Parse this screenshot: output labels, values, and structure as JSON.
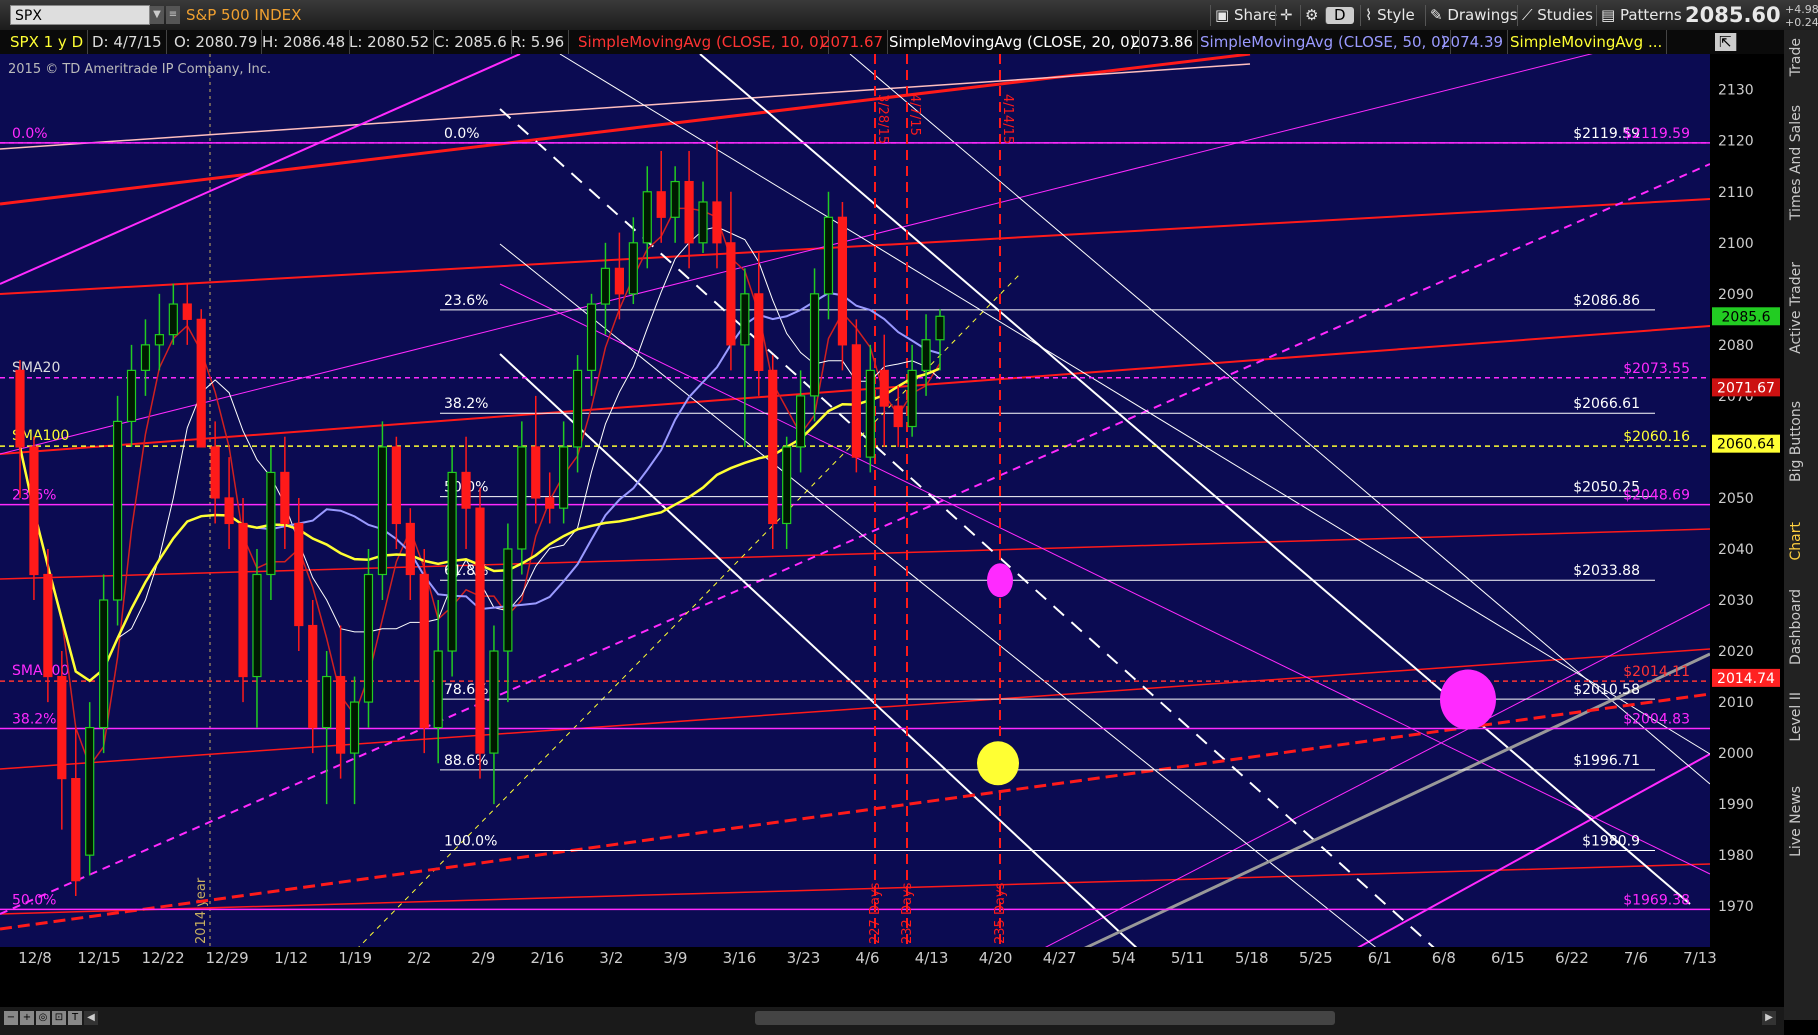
{
  "toolbar": {
    "symbol": "SPX",
    "name": "S&P 500 INDEX",
    "share": "Share",
    "d_label": "D",
    "style": "Style",
    "drawings": "Drawings",
    "studies": "Studies",
    "patterns": "Patterns",
    "last": "2085.60",
    "chg1": "+4.98",
    "chg2": "+0.24%"
  },
  "infobar": {
    "sym": "SPX 1 y D",
    "date": "D: 4/7/15",
    "open": "O: 2080.79",
    "high": "H: 2086.48",
    "low": "L: 2080.52",
    "close": "C: 2085.6",
    "range": "R: 5.96",
    "sma10": "SimpleMovingAvg (CLOSE, 10, 0)",
    "sma10v": "2071.67",
    "sma20": "SimpleMovingAvg (CLOSE, 20, 0)",
    "sma20v": "2073.86",
    "sma50": "SimpleMovingAvg (CLOSE, 50, 0)",
    "sma50v": "2074.39",
    "smaMore": "SimpleMovingAvg ..."
  },
  "copyright": "2015 © TD Ameritrade IP Company, Inc.",
  "colors": {
    "bg": "#0b0b52",
    "red": "#ff1a1a",
    "magenta": "#ff2aff",
    "yellow": "#ffff33",
    "white": "#ffffff",
    "green": "#22cc22"
  },
  "right_tabs": [
    "Trade",
    "Times And Sales",
    "Active Trader",
    "Big Buttons",
    "Chart",
    "Dashboard",
    "Level II",
    "Live News"
  ],
  "chart_data": {
    "type": "candlestick",
    "ylim": [
      1962,
      2137
    ],
    "y_ticks": [
      1970,
      1980,
      1990,
      2000,
      2010,
      2020,
      2030,
      2040,
      2050,
      2060,
      2070,
      2080,
      2090,
      2100,
      2110,
      2120,
      2130
    ],
    "x_ticks": [
      "12/8",
      "12/15",
      "12/22",
      "12/29",
      "1/12",
      "1/19",
      "2/2",
      "2/9",
      "2/16",
      "3/2",
      "3/9",
      "3/16",
      "3/23",
      "4/6",
      "4/13",
      "4/20",
      "4/27",
      "5/4",
      "5/11",
      "5/18",
      "5/25",
      "6/1",
      "6/8",
      "6/15",
      "6/22",
      "7/6",
      "7/13"
    ],
    "fib_right": [
      {
        "pct": "0.0%",
        "price": "$2119.59",
        "value": 2119.59
      },
      {
        "pct": "23.6%",
        "price": "$2086.86",
        "value": 2086.86
      },
      {
        "pct": "38.2%",
        "price": "$2066.61",
        "value": 2066.61
      },
      {
        "pct": "50.0%",
        "price": "$2050.25",
        "value": 2050.25
      },
      {
        "pct": "61.8%",
        "price": "$2033.88",
        "value": 2033.88
      },
      {
        "pct": "78.6%",
        "price": "$2010.58",
        "value": 2010.58
      },
      {
        "pct": "88.6%",
        "price": "$1996.71",
        "value": 1996.71
      },
      {
        "pct": "100.0%",
        "price": "$1980.9",
        "value": 1980.9
      }
    ],
    "fib_left": [
      {
        "pct": "0.0%",
        "value": 2119.59
      },
      {
        "pct": "23.6%",
        "value": 2048.69,
        "price": "$2048.69"
      },
      {
        "pct": "38.2%",
        "value": 2004.83,
        "price": "$2004.83"
      },
      {
        "pct": "50.0%",
        "value": 1969.38,
        "price": "$1969.38"
      }
    ],
    "right_price_labels": [
      {
        "text": "$2119.59",
        "value": 2119.59
      },
      {
        "text": "$2073.55",
        "value": 2073.55
      },
      {
        "text": "$2060.16",
        "value": 2060.16
      },
      {
        "text": "$2014.11",
        "value": 2014.11
      }
    ],
    "price_tags": [
      {
        "text": "2085.6",
        "value": 2085.6,
        "color": "#22cc22"
      },
      {
        "text": "2071.67",
        "value": 2071.67,
        "color": "#cc1111"
      },
      {
        "text": "2060.64",
        "value": 2060.64,
        "color": "#ffff33"
      },
      {
        "text": "2014.74",
        "value": 2014.74,
        "color": "#ff2222"
      }
    ],
    "sma_labels": [
      {
        "text": "SMA20",
        "value": 2073.55
      },
      {
        "text": "SMA100",
        "value": 2060.16
      },
      {
        "text": "SMA200",
        "value": 2014.11
      }
    ],
    "vlines": [
      {
        "top": "3/28/15",
        "bottom": "227 Days"
      },
      {
        "top": "4/7/15",
        "bottom": "232 Days"
      },
      {
        "top": "4/14/15",
        "bottom": "235 Days"
      }
    ],
    "year_label": "2014 year",
    "candles": [
      [
        2075,
        2077,
        2050,
        2060
      ],
      [
        2060,
        2062,
        2030,
        2035
      ],
      [
        2035,
        2040,
        2010,
        2015
      ],
      [
        2015,
        2020,
        1985,
        1995
      ],
      [
        1995,
        2005,
        1972,
        1975
      ],
      [
        1980,
        2010,
        1976,
        2005
      ],
      [
        2005,
        2035,
        2000,
        2030
      ],
      [
        2030,
        2070,
        2025,
        2065
      ],
      [
        2065,
        2080,
        2060,
        2075
      ],
      [
        2075,
        2085,
        2070,
        2080
      ],
      [
        2080,
        2090,
        2075,
        2082
      ],
      [
        2082,
        2092,
        2080,
        2088
      ],
      [
        2088,
        2092,
        2080,
        2085
      ],
      [
        2085,
        2087,
        2060,
        2060
      ],
      [
        2060,
        2065,
        2045,
        2050
      ],
      [
        2050,
        2058,
        2040,
        2045
      ],
      [
        2045,
        2050,
        2010,
        2015
      ],
      [
        2015,
        2040,
        2005,
        2035
      ],
      [
        2035,
        2060,
        2030,
        2055
      ],
      [
        2055,
        2062,
        2040,
        2045
      ],
      [
        2045,
        2050,
        2020,
        2025
      ],
      [
        2025,
        2030,
        2000,
        2005
      ],
      [
        2005,
        2020,
        1990,
        2015
      ],
      [
        2015,
        2025,
        1995,
        2000
      ],
      [
        2000,
        2015,
        1990,
        2010
      ],
      [
        2010,
        2040,
        2005,
        2035
      ],
      [
        2035,
        2065,
        2030,
        2060
      ],
      [
        2060,
        2062,
        2040,
        2045
      ],
      [
        2045,
        2048,
        2030,
        2035
      ],
      [
        2035,
        2040,
        2000,
        2005
      ],
      [
        2005,
        2030,
        1998,
        2020
      ],
      [
        2020,
        2060,
        2015,
        2055
      ],
      [
        2055,
        2062,
        2040,
        2048
      ],
      [
        2048,
        2052,
        1995,
        2000
      ],
      [
        2000,
        2025,
        1990,
        2020
      ],
      [
        2020,
        2045,
        2010,
        2040
      ],
      [
        2040,
        2065,
        2035,
        2060
      ],
      [
        2060,
        2070,
        2045,
        2050
      ],
      [
        2050,
        2055,
        2045,
        2048
      ],
      [
        2048,
        2065,
        2045,
        2060
      ],
      [
        2060,
        2078,
        2055,
        2075
      ],
      [
        2075,
        2090,
        2070,
        2088
      ],
      [
        2088,
        2100,
        2082,
        2095
      ],
      [
        2095,
        2102,
        2085,
        2090
      ],
      [
        2090,
        2105,
        2088,
        2100
      ],
      [
        2100,
        2115,
        2095,
        2110
      ],
      [
        2110,
        2118,
        2100,
        2105
      ],
      [
        2105,
        2115,
        2100,
        2112
      ],
      [
        2112,
        2118,
        2095,
        2100
      ],
      [
        2100,
        2112,
        2098,
        2108
      ],
      [
        2108,
        2120,
        2095,
        2100
      ],
      [
        2100,
        2110,
        2075,
        2080
      ],
      [
        2080,
        2095,
        2060,
        2090
      ],
      [
        2090,
        2098,
        2070,
        2075
      ],
      [
        2075,
        2078,
        2040,
        2045
      ],
      [
        2045,
        2062,
        2040,
        2060
      ],
      [
        2060,
        2075,
        2055,
        2070
      ],
      [
        2070,
        2095,
        2065,
        2090
      ],
      [
        2090,
        2110,
        2085,
        2105
      ],
      [
        2105,
        2108,
        2075,
        2080
      ],
      [
        2080,
        2085,
        2055,
        2058
      ],
      [
        2058,
        2080,
        2055,
        2075
      ],
      [
        2075,
        2082,
        2060,
        2068
      ],
      [
        2068,
        2072,
        2060,
        2064
      ],
      [
        2064,
        2080,
        2062,
        2075
      ],
      [
        2075,
        2086,
        2070,
        2081
      ],
      [
        2081,
        2087,
        2075,
        2085.6
      ]
    ]
  }
}
